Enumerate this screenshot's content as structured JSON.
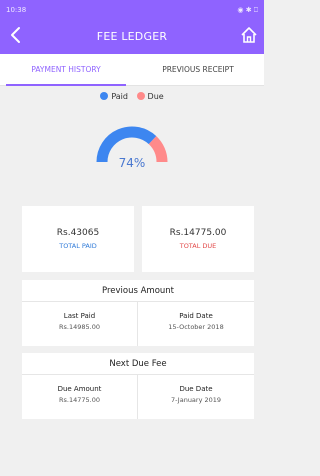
{
  "status_bar": {
    "time": "10:38",
    "right": "◉ ✱ ⎕"
  },
  "header": {
    "title": "FEE LEDGER"
  },
  "tabs": [
    {
      "label": "PAYMENT HISTORY"
    },
    {
      "label": "PREVIOUS RECEIPT"
    }
  ],
  "legend": [
    {
      "label": "Paid",
      "color": "#3d86f0"
    },
    {
      "label": "Due",
      "color": "#ff8a8a"
    }
  ],
  "gauge": {
    "percent_label": "74%",
    "paid_fraction": 0.74
  },
  "summary": {
    "paid": {
      "amount": "Rs.43065",
      "label": "TOTAL PAID"
    },
    "due": {
      "amount": "Rs.14775.00",
      "label": "TOTAL DUE"
    }
  },
  "previous_amount": {
    "title": "Previous Amount",
    "left": {
      "label": "Last Paid",
      "value": "Rs.14985.00"
    },
    "right": {
      "label": "Paid Date",
      "value": "15-October 2018"
    }
  },
  "next_due": {
    "title": "Next Due Fee",
    "left": {
      "label": "Due Amount",
      "value": "Rs.14775.00"
    },
    "right": {
      "label": "Due Date",
      "value": "7-January 2019"
    }
  },
  "colors": {
    "header": "#8f63ff",
    "paid": "#3d86f0",
    "due": "#ff8a8a",
    "background": "#f0f0f0"
  }
}
